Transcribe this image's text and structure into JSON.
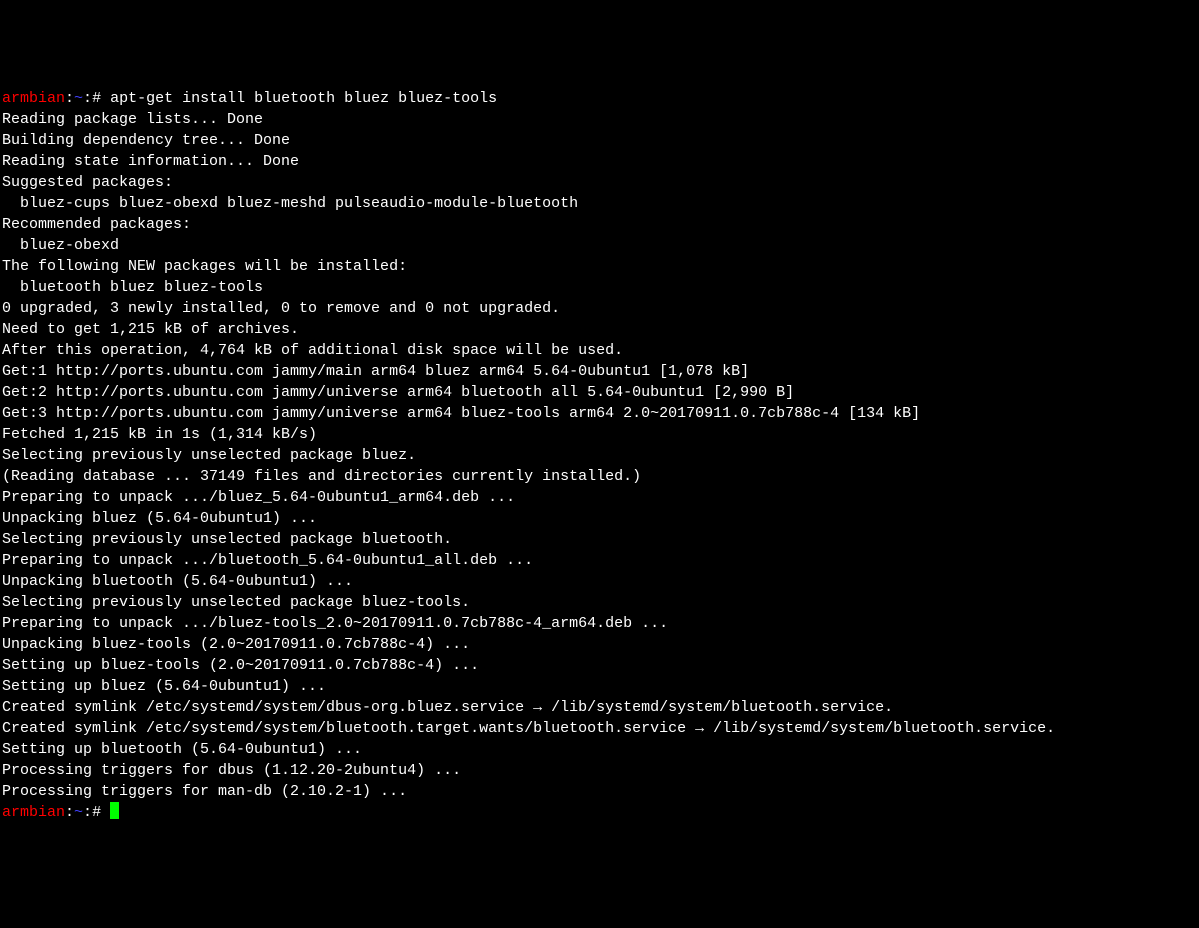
{
  "prompt": {
    "host": "armbian",
    "separator1": ":",
    "path": "~",
    "separator2": ":",
    "hash": "#"
  },
  "command1": "apt-get install bluetooth bluez bluez-tools",
  "lines": [
    "Reading package lists... Done",
    "Building dependency tree... Done",
    "Reading state information... Done",
    "Suggested packages:",
    "  bluez-cups bluez-obexd bluez-meshd pulseaudio-module-bluetooth",
    "Recommended packages:",
    "  bluez-obexd",
    "The following NEW packages will be installed:",
    "  bluetooth bluez bluez-tools",
    "0 upgraded, 3 newly installed, 0 to remove and 0 not upgraded.",
    "Need to get 1,215 kB of archives.",
    "After this operation, 4,764 kB of additional disk space will be used.",
    "Get:1 http://ports.ubuntu.com jammy/main arm64 bluez arm64 5.64-0ubuntu1 [1,078 kB]",
    "Get:2 http://ports.ubuntu.com jammy/universe arm64 bluetooth all 5.64-0ubuntu1 [2,990 B]",
    "Get:3 http://ports.ubuntu.com jammy/universe arm64 bluez-tools arm64 2.0~20170911.0.7cb788c-4 [134 kB]",
    "Fetched 1,215 kB in 1s (1,314 kB/s)",
    "Selecting previously unselected package bluez.",
    "(Reading database ... 37149 files and directories currently installed.)",
    "Preparing to unpack .../bluez_5.64-0ubuntu1_arm64.deb ...",
    "Unpacking bluez (5.64-0ubuntu1) ...",
    "Selecting previously unselected package bluetooth.",
    "Preparing to unpack .../bluetooth_5.64-0ubuntu1_all.deb ...",
    "Unpacking bluetooth (5.64-0ubuntu1) ...",
    "Selecting previously unselected package bluez-tools.",
    "Preparing to unpack .../bluez-tools_2.0~20170911.0.7cb788c-4_arm64.deb ...",
    "Unpacking bluez-tools (2.0~20170911.0.7cb788c-4) ...",
    "Setting up bluez-tools (2.0~20170911.0.7cb788c-4) ...",
    "Setting up bluez (5.64-0ubuntu1) ...",
    "Created symlink /etc/systemd/system/dbus-org.bluez.service → /lib/systemd/system/bluetooth.service.",
    "Created symlink /etc/systemd/system/bluetooth.target.wants/bluetooth.service → /lib/systemd/system/bluetooth.service.",
    "Setting up bluetooth (5.64-0ubuntu1) ...",
    "Processing triggers for dbus (1.12.20-2ubuntu4) ...",
    "Processing triggers for man-db (2.10.2-1) ..."
  ]
}
